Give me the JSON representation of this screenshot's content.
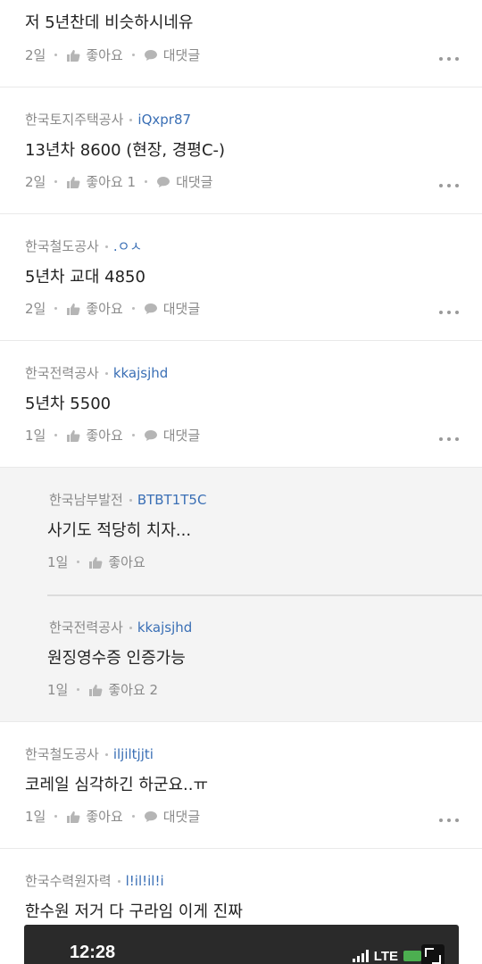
{
  "comments": [
    {
      "company": "",
      "nickname": "",
      "text": "저 5년찬데 비슷하시네유",
      "time": "2일",
      "like": "좋아요",
      "reply": "대댓글"
    },
    {
      "company": "한국토지주택공사",
      "nickname": "iQxpr87",
      "text": "13년차 8600 (현장, 경평C-)",
      "time": "2일",
      "like": "좋아요 1",
      "reply": "대댓글"
    },
    {
      "company": "한국철도공사",
      "nickname": ".ㅇㅅ",
      "text": "5년차 교대 4850",
      "time": "2일",
      "like": "좋아요",
      "reply": "대댓글"
    },
    {
      "company": "한국전력공사",
      "nickname": "kkajsjhd",
      "text": "5년차 5500",
      "time": "1일",
      "like": "좋아요",
      "reply": "대댓글"
    }
  ],
  "replies": [
    {
      "company": "한국남부발전",
      "nickname": "BTBT1T5C",
      "text": "사기도 적당히 치자...",
      "time": "1일",
      "like": "좋아요"
    },
    {
      "company": "한국전력공사",
      "nickname": "kkajsjhd",
      "text": "원징영수증 인증가능",
      "time": "1일",
      "like": "좋아요 2"
    }
  ],
  "comments2": [
    {
      "company": "한국철도공사",
      "nickname": "iljiltjjti",
      "text": "코레일 심각하긴 하군요..ㅠ",
      "time": "1일",
      "like": "좋아요",
      "reply": "대댓글"
    },
    {
      "company": "한국수력원자력",
      "nickname": "l!il!il!i",
      "text": "한수원 저거 다 구라임 이게 진짜"
    }
  ],
  "attached_image": {
    "time": "12:28",
    "network": "LTE"
  },
  "icons": {
    "like": "thumbs-up-icon",
    "reply": "speech-bubble-icon",
    "more": "more-dots-icon"
  },
  "colors": {
    "nickname": "#3a6fb5",
    "meta": "#8a8a8a",
    "reply_bg": "#f4f4f4"
  }
}
